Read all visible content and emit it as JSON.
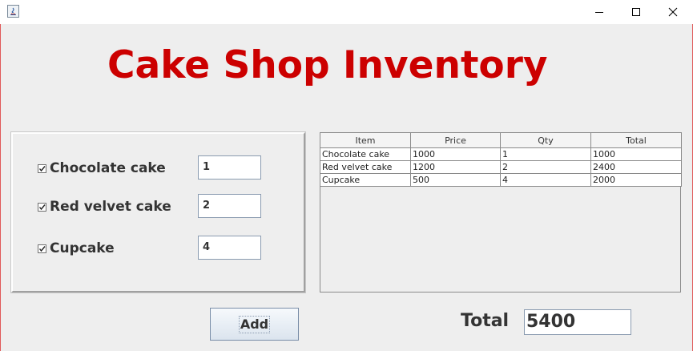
{
  "window": {
    "title": "",
    "controls": {
      "minimize": "minimize-icon",
      "maximize": "maximize-icon",
      "close": "close-icon"
    }
  },
  "header": {
    "title": "Cake Shop Inventory",
    "title_color": "#cc0000"
  },
  "items": [
    {
      "label": "Chocolate cake",
      "checked": true,
      "qty": "1"
    },
    {
      "label": "Red velvet cake",
      "checked": true,
      "qty": "2"
    },
    {
      "label": "Cupcake",
      "checked": true,
      "qty": "4"
    }
  ],
  "table": {
    "columns": [
      "Item",
      "Price",
      "Qty",
      "Total"
    ],
    "rows": [
      [
        "Chocolate cake",
        "1000",
        "1",
        "1000"
      ],
      [
        "Red velvet cake",
        "1200",
        "2",
        "2400"
      ],
      [
        "Cupcake",
        "500",
        "4",
        "2000"
      ]
    ]
  },
  "actions": {
    "add_label": "Add"
  },
  "summary": {
    "total_label": "Total",
    "total_value": "5400"
  }
}
